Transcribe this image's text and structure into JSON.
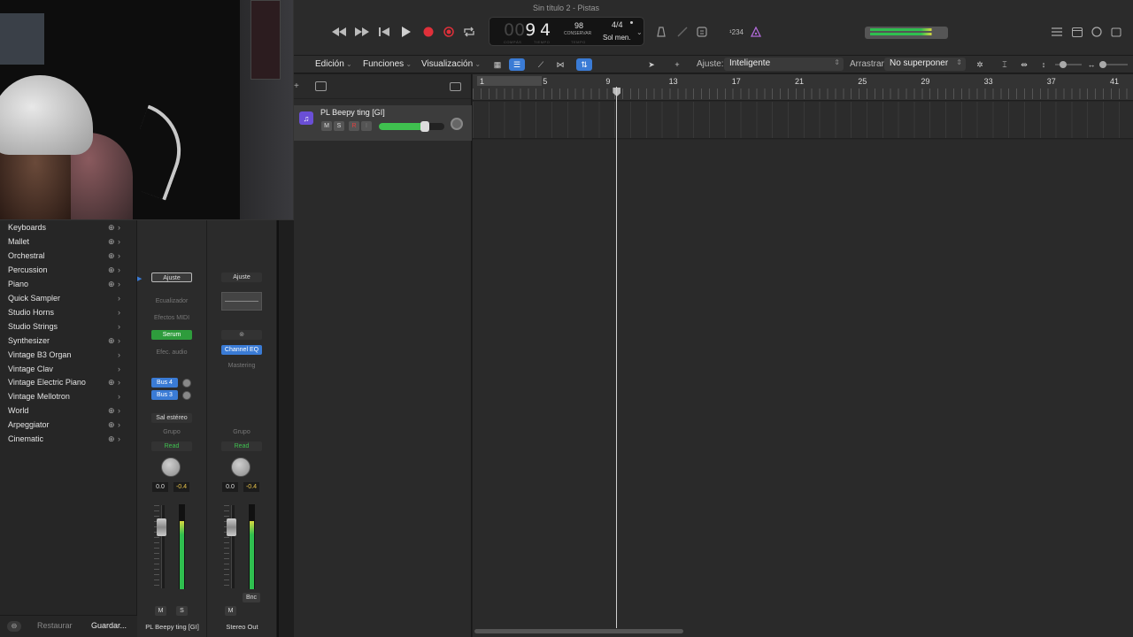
{
  "window": {
    "title": "Sin título 2 - Pistas"
  },
  "transport": {
    "rewind_icon": "rewind-icon",
    "forward_icon": "fast-forward-icon",
    "to_start_icon": "go-to-start-icon",
    "play_icon": "play-icon",
    "record_icon": "record-icon",
    "capture_icon": "capture-record-icon",
    "cycle_icon": "cycle-icon",
    "record_color": "#e0303a"
  },
  "lcd": {
    "bars_dim": "00",
    "bars": "9",
    "beat": "4",
    "bars_label": "COMPÁS",
    "beat_label": "TIEMPO",
    "tempo": "98",
    "tempo_mode": "CONSERVAR",
    "tempo_label": "TEMPO",
    "signature": "4/4",
    "key": "Sol men."
  },
  "count_in": "¹234",
  "toolbar": {
    "edit": "Edición",
    "functions": "Funciones",
    "view": "Visualización",
    "snap_label": "Ajuste:",
    "snap_value": "Inteligente",
    "drag_label": "Arrastrar:",
    "drag_value": "No superponer",
    "accent": "#3a7bd5"
  },
  "track": {
    "name": "PL Beepy ting [GI]",
    "mute": "M",
    "solo": "S",
    "record": "R",
    "input": "I",
    "volume_fraction": 0.7,
    "color": "#6a4fd6"
  },
  "ruler": {
    "bars": [
      "1",
      "5",
      "9",
      "13",
      "17",
      "21",
      "25",
      "29",
      "33",
      "37",
      "41"
    ],
    "playhead_bar": 9
  },
  "library": {
    "items": [
      {
        "label": "Keyboards",
        "download": true
      },
      {
        "label": "Mallet",
        "download": true
      },
      {
        "label": "Orchestral",
        "download": true
      },
      {
        "label": "Percussion",
        "download": true
      },
      {
        "label": "Piano",
        "download": true
      },
      {
        "label": "Quick Sampler",
        "download": false
      },
      {
        "label": "Studio Horns",
        "download": false
      },
      {
        "label": "Studio Strings",
        "download": false
      },
      {
        "label": "Synthesizer",
        "download": true
      },
      {
        "label": "Vintage B3 Organ",
        "download": false
      },
      {
        "label": "Vintage Clav",
        "download": false
      },
      {
        "label": "Vintage Electric Piano",
        "download": true
      },
      {
        "label": "Vintage Mellotron",
        "download": false
      },
      {
        "label": "World",
        "download": true
      },
      {
        "label": "Arpeggiator",
        "download": true
      },
      {
        "label": "Cinematic",
        "download": true
      }
    ],
    "restore": "Restaurar",
    "save": "Guardar..."
  },
  "strips": {
    "inst": {
      "setting": "Ajuste",
      "eq": "Ecualizador",
      "midi_fx": "Efectos MIDI",
      "instrument": "Serum",
      "audio_fx": "Efec. audio",
      "sends": [
        "Bus 4",
        "Bus 3"
      ],
      "output": "Sal estéreo",
      "group": "Grupo",
      "automation": "Read",
      "pan": "0.0",
      "peak": "-0.4",
      "mute": "M",
      "solo": "S",
      "name": "PL Beepy ting [GI]",
      "meter_fraction": 0.8
    },
    "out": {
      "setting": "Ajuste",
      "link_icon": "link-icon",
      "plugin": "Channel EQ",
      "mastering": "Mastering",
      "group": "Grupo",
      "automation": "Read",
      "pan": "0.0",
      "peak": "-0.4",
      "bounce": "Bnc",
      "mute": "M",
      "name": "Stereo Out",
      "meter_fraction": 0.8
    }
  }
}
